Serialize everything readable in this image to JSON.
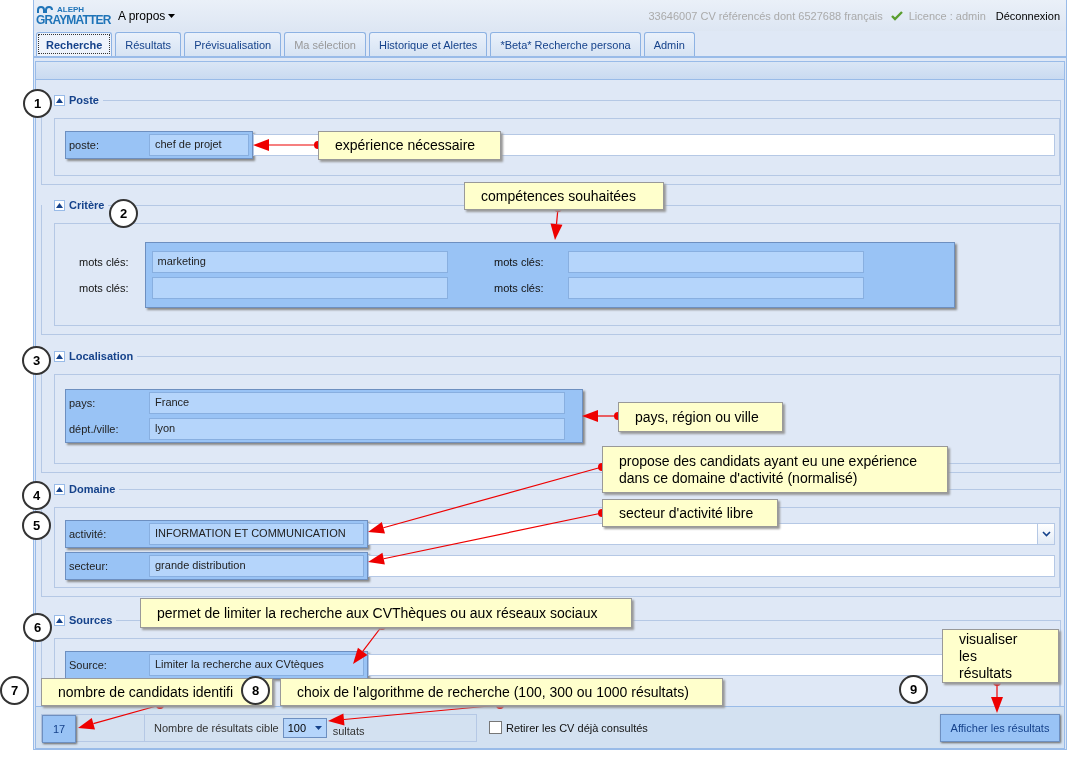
{
  "header": {
    "logo_top": "ALEPH",
    "logo_main": "GRAYMATTER",
    "menu": "A propos",
    "stats": "33646007 CV référencés dont 6527688 français",
    "licence": "Licence : admin",
    "logout": "Déconnexion"
  },
  "tabs": [
    {
      "label": "Recherche",
      "selected": true,
      "disabled": false
    },
    {
      "label": "Résultats",
      "selected": false,
      "disabled": false
    },
    {
      "label": "Prévisualisation",
      "selected": false,
      "disabled": false
    },
    {
      "label": "Ma sélection",
      "selected": false,
      "disabled": true
    },
    {
      "label": "Historique et Alertes",
      "selected": false,
      "disabled": false
    },
    {
      "label": "*Beta* Recherche persona",
      "selected": false,
      "disabled": false
    },
    {
      "label": "Admin",
      "selected": false,
      "disabled": false
    }
  ],
  "sections": [
    {
      "title": "Poste",
      "kind": "single",
      "expanded": true,
      "fields": [
        {
          "label": "poste:",
          "value": "chef de projet"
        }
      ]
    },
    {
      "title": "Critère",
      "kind": "grid",
      "expanded": true,
      "fields": [
        {
          "label": "mots clés:",
          "value": "marketing"
        },
        {
          "label": "mots clés:"
        },
        {
          "label": "mots clés:"
        },
        {
          "label": "mots clés:"
        }
      ]
    },
    {
      "title": "Localisation",
      "kind": "stack",
      "expanded": true,
      "fields": [
        {
          "label": "pays:",
          "value": "France"
        },
        {
          "label": "dépt./ville:",
          "value": "lyon"
        }
      ]
    },
    {
      "title": "Domaine",
      "kind": "single",
      "expanded": true,
      "fields": [
        {
          "label": "activité:",
          "value": "INFORMATION ET COMMUNICATION",
          "dropdown": true
        },
        {
          "label": "secteur:",
          "value": "grande distribution",
          "dropdown": false
        }
      ]
    },
    {
      "title": "Sources",
      "kind": "single",
      "expanded": true,
      "fields": [
        {
          "label": "Source:",
          "value": "Limiter la recherche aux CVtèques"
        }
      ]
    }
  ],
  "footer": {
    "count": "17",
    "target_label": "Nombre de résultats cible",
    "target_value": "100",
    "target_suffix": "sultats",
    "exclude": {
      "label": "Retirer les CV déjà consultés",
      "checked": false
    },
    "button": "Afficher les résultats"
  },
  "markers": [
    "1",
    "2",
    "3",
    "4",
    "5",
    "6",
    "7",
    "8",
    "9"
  ],
  "callouts": [
    {
      "text": "expérience nécessaire"
    },
    {
      "text": "compétences souhaitées"
    },
    {
      "text": "pays, région ou ville"
    },
    {
      "text": "propose des candidats ayant eu une expérience dans ce domaine d'activité (normalisé)"
    },
    {
      "text": "secteur d'activité libre"
    },
    {
      "text": "permet de limiter la recherche aux CVThèques ou aux réseaux sociaux"
    },
    {
      "text": "nombre de candidats identifi"
    },
    {
      "text": "choix de l'algorithme de recherche (100, 300 ou 1000 résultats)"
    },
    {
      "text": "visualiser les résultats"
    }
  ]
}
